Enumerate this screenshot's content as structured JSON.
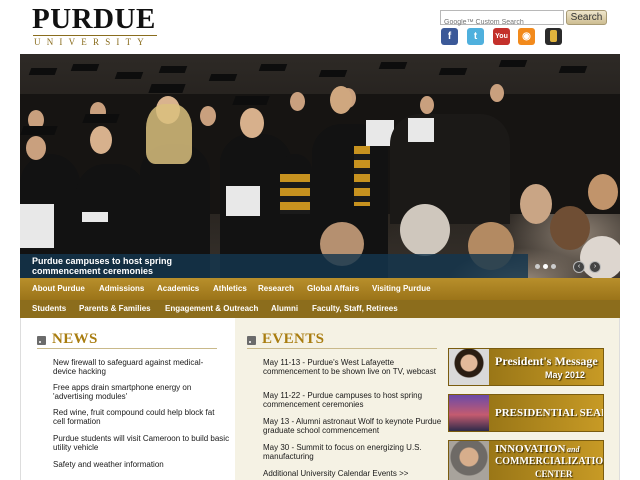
{
  "header": {
    "logo_main": "PURDUE",
    "logo_sub": "UNIVERSITY",
    "search_placeholder": "Google™ Custom Search",
    "search_button": "Search",
    "social": {
      "facebook": "f",
      "twitter": "t",
      "youtube": "You",
      "rss": "◉"
    }
  },
  "hero": {
    "caption": "Purdue campuses to host spring commencement ceremonies",
    "prev": "‹",
    "next": "›"
  },
  "nav": {
    "primary": [
      "About Purdue",
      "Admissions",
      "Academics",
      "Athletics",
      "Research",
      "Global Affairs",
      "Visiting Purdue"
    ],
    "secondary": [
      "Students",
      "Parents & Families",
      "Engagement & Outreach",
      "Alumni",
      "Faculty, Staff, Retirees"
    ]
  },
  "news": {
    "title": "NEWS",
    "items": [
      "New firewall to safeguard against medical-device hacking",
      "Free apps drain smartphone energy on 'advertising modules'",
      "Red wine, fruit compound could help block fat cell formation",
      "Purdue students will visit Cameroon to build basic utility vehicle",
      "Safety and weather information"
    ]
  },
  "events": {
    "title": "EVENTS",
    "items": [
      "May 11-13 - Purdue's West Lafayette commencement to be shown live on TV, webcast",
      "May 11-22 - Purdue campuses to host spring commencement ceremonies",
      "May 13 - Alumni astronaut Wolf to keynote Purdue graduate school commencement",
      "May 30 - Summit to focus on energizing U.S. manufacturing",
      "Additional University Calendar Events >>"
    ]
  },
  "promos": {
    "president_title": "President's Message",
    "president_date": "May 2012",
    "search_title": "PRESIDENTIAL SEARCH",
    "innovation_line1": "INNOVATION",
    "innovation_and": "and",
    "innovation_line2": "COMMERCIALIZATION",
    "innovation_line3": "CENTER"
  },
  "colors": {
    "gold": "#b88f2b",
    "dark_gold": "#8c6d1c",
    "heading_gold": "#a97d10",
    "caption_bg": "#14364e"
  }
}
